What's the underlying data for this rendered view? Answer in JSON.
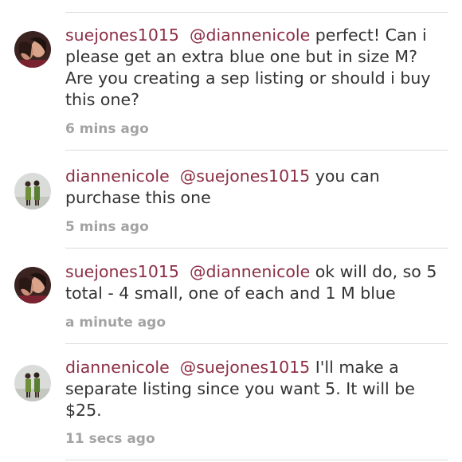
{
  "comments": [
    {
      "username": "suejones1015",
      "mention": "@diannenicole",
      "text": " perfect! Can i please get an extra blue one but in size M? Are you creating a sep listing or should i buy this one?",
      "time": "6 mins ago",
      "avatar_icon": "couple-selfie-avatar"
    },
    {
      "username": "diannenicole",
      "mention": "@suejones1015",
      "text": " you can purchase this one",
      "time": "5 mins ago",
      "avatar_icon": "two-people-standing-avatar"
    },
    {
      "username": "suejones1015",
      "mention": "@diannenicole",
      "text": " ok will do, so 5 total - 4 small, one of each and 1 M blue",
      "time": "a minute ago",
      "avatar_icon": "couple-selfie-avatar"
    },
    {
      "username": "diannenicole",
      "mention": "@suejones1015",
      "text": " I'll make a separate listing since you want 5.  It will be $25.",
      "time": "11 secs ago",
      "avatar_icon": "two-people-standing-avatar"
    }
  ],
  "colors": {
    "link": "#8c2f45",
    "body_text": "#333333",
    "timestamp": "#a3a3a3",
    "divider": "#dcdcdc"
  }
}
